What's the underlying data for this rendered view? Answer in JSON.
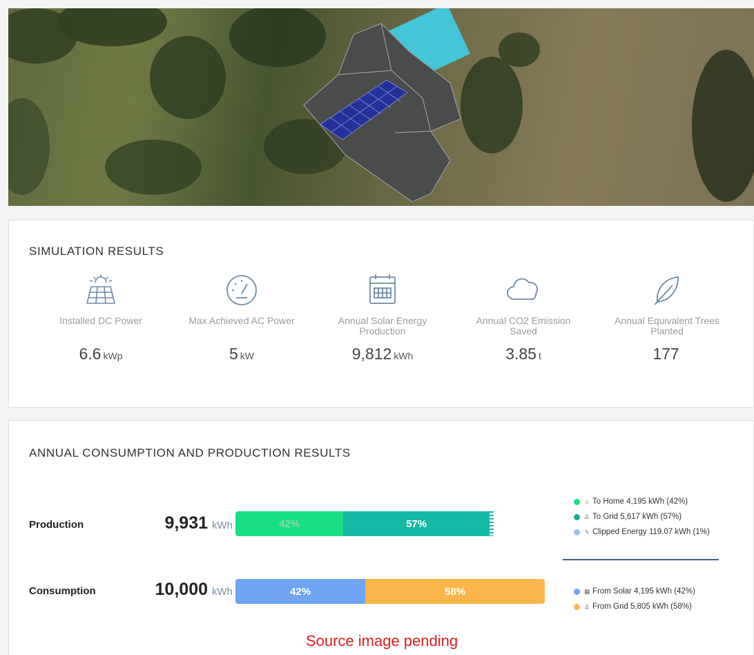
{
  "simulation": {
    "title": "SIMULATION RESULTS",
    "metrics": [
      {
        "icon": "solar-panel-icon",
        "label": "Installed DC Power",
        "value": "6.6",
        "unit": "kWp"
      },
      {
        "icon": "gauge-icon",
        "label": "Max Achieved AC Power",
        "value": "5",
        "unit": "kW"
      },
      {
        "icon": "calendar-icon",
        "label": "Annual Solar Energy Production",
        "value": "9,812",
        "unit": "kWh"
      },
      {
        "icon": "co2-cloud-icon",
        "label": "Annual CO2 Emission Saved",
        "value": "3.85",
        "unit": "t"
      },
      {
        "icon": "leaf-icon",
        "label": "Annual Equivalent Trees Planted",
        "value": "177",
        "unit": ""
      }
    ]
  },
  "annual": {
    "title": "ANNUAL CONSUMPTION AND PRODUCTION RESULTS",
    "production": {
      "label": "Production",
      "total": "9,931",
      "unit": "kWh",
      "segments": [
        {
          "label": "42%",
          "percent": 42,
          "color": "#19dd83",
          "text_color": "#8fd6a8"
        },
        {
          "label": "57%",
          "percent": 57,
          "color": "#16b9a5",
          "text_color": "#ffffff"
        }
      ],
      "legend": [
        {
          "icon": "home-icon",
          "glyph": "⌂",
          "text": "To Home 4,195 kWh (42%)",
          "color": "#19dd83"
        },
        {
          "icon": "grid-tower-icon",
          "glyph": "♙",
          "text": "To Grid 5,617 kWh (57%)",
          "color": "#14a993"
        },
        {
          "icon": "clip-icon",
          "glyph": "ϟ",
          "text": "Clipped Energy 119.07 kWh (1%)",
          "color": "#9cc0ec"
        }
      ]
    },
    "consumption": {
      "label": "Consumption",
      "total": "10,000",
      "unit": "kWh",
      "segments": [
        {
          "label": "42%",
          "percent": 42,
          "color": "#6ea4f2",
          "text_color": "#ffffff"
        },
        {
          "label": "58%",
          "percent": 58,
          "color": "#fbb64a",
          "text_color": "#ffffff"
        }
      ],
      "legend": [
        {
          "icon": "solar-mini-icon",
          "glyph": "▦",
          "text": "From Solar 4,195 kWh (42%)",
          "color": "#6ea4f2"
        },
        {
          "icon": "grid-tower-icon",
          "glyph": "♙",
          "text": "From Grid 5,805 kWh (58%)",
          "color": "#fbb64a"
        }
      ]
    }
  },
  "status": {
    "pending": "Source image pending"
  }
}
